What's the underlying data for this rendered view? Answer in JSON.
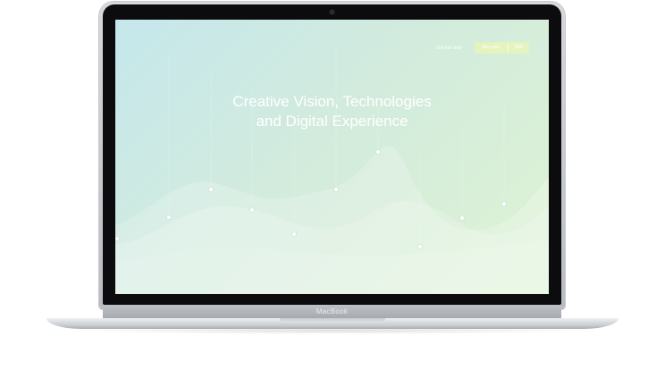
{
  "device": {
    "brand_label": "MacBook"
  },
  "website": {
    "nav": {
      "trial_link": "Get free trial",
      "buy_button": "Buy now",
      "price": "$32"
    },
    "hero": {
      "line1": "Creative Vision, Technologies",
      "line2": "and Digital Experience"
    }
  }
}
